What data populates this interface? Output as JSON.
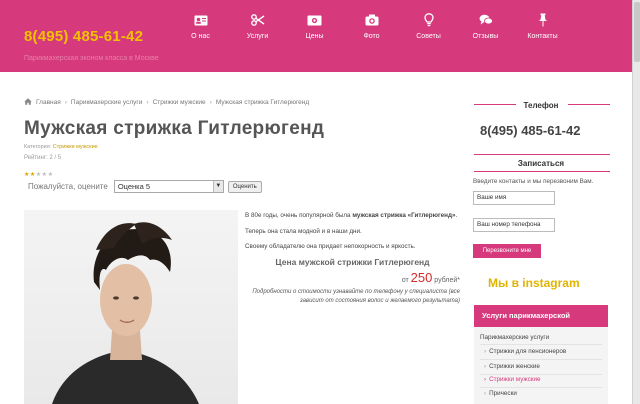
{
  "header": {
    "phone": "8(495) 485-61-42",
    "tagline": "Парикмахерская эконом класса в Москве",
    "nav": [
      {
        "label": "О нас",
        "icon": "id-card-icon"
      },
      {
        "label": "Услуги",
        "icon": "scissors-icon"
      },
      {
        "label": "Цены",
        "icon": "money-icon"
      },
      {
        "label": "Фото",
        "icon": "camera-icon"
      },
      {
        "label": "Советы",
        "icon": "lightbulb-icon"
      },
      {
        "label": "Отзывы",
        "icon": "comments-icon"
      },
      {
        "label": "Контакты",
        "icon": "pin-icon"
      }
    ]
  },
  "breadcrumbs": [
    "Главная",
    "Парикмахерские услуги",
    "Стрижки мужские",
    "Мужская стрижка Гитлерюгенд"
  ],
  "title": "Мужская стрижка Гитлерюгенд",
  "meta": {
    "category_label": "Категория:",
    "category": "Стрижки мужские",
    "rating_label": "Рейтинг:",
    "rating": "2 / 5",
    "stars_filled": 2,
    "stars_total": 5
  },
  "rating_form": {
    "prompt": "Пожалуйста, оцените",
    "selected": "Оценка 5",
    "button": "Оценить"
  },
  "article": {
    "p1_start": "В 80е годы, очень популярной была ",
    "p1_bold": "мужская стрижка «Гитлерюгенд»",
    "p1_end": ".",
    "p2": "Теперь она стала модной и в наши дни.",
    "p3": "Своему обладателю она придает непокорность и яркость.",
    "price_title": "Цена мужской стрижки Гитлерюгенд",
    "price_prefix": "от",
    "price_value": "250",
    "price_suffix": "рублей*",
    "price_note": "Подробности о стоимости узнавайте по телефону у специалиста (все зависит от состояния волос и желаемого результата)"
  },
  "sidebar": {
    "phone_title": "Телефон",
    "phone": "8(495) 485-61-42",
    "signup_title": "Записаться",
    "signup_text": "Введите контакты и мы перезвоним Вам.",
    "name_placeholder": "Ваше имя",
    "phone_placeholder": "Ваш номер телефона",
    "callback_button": "Перезвоните мне",
    "instagram": "Мы в instagram",
    "services_title": "Услуги парикмахерской",
    "services_root": "Парикмахерские услуги",
    "services": [
      {
        "label": "Стрижки для пенсионеров",
        "active": false
      },
      {
        "label": "Стрижки женские",
        "active": false
      },
      {
        "label": "Стрижки мужские",
        "active": true
      },
      {
        "label": "Прически",
        "active": false
      }
    ]
  },
  "colors": {
    "brand": "#d63a7c",
    "accent": "#f2c200",
    "price": "#d62a2a"
  }
}
